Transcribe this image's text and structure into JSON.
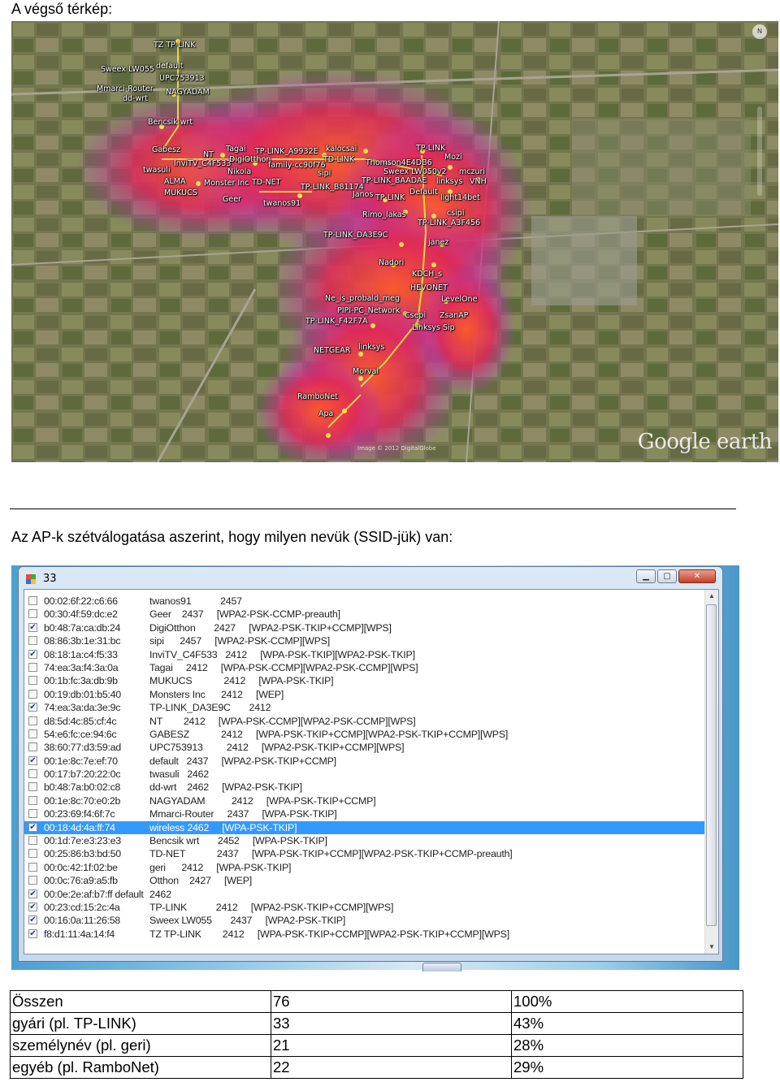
{
  "headings": {
    "map": "A végső térkép:",
    "list": "Az AP-k szétválogatása aszerint, hogy milyen nevük (SSID-jük) van:"
  },
  "map": {
    "attribution": "Image © 2012 DigitalGlobe",
    "brand": "Google earth",
    "compass": "N",
    "labels": [
      "TZ TP-LINK",
      "Sweex LW055",
      "default",
      "UPC753913",
      "Mmarci-Router",
      "NAGYADAM",
      "dd-wrt",
      "Bencsik wrt",
      "Gabesz",
      "NT",
      "Tagai",
      "TP-LINK_A9932E",
      "kalocsai",
      "InviTV_C4F533",
      "DigiOtthon",
      "family-cc90f76",
      "TD-LINK",
      "twasuli",
      "Nikola",
      "sipi",
      "Thomson4E4DB6",
      "TP-LINK",
      "Mozi",
      "Sweex LW050v2",
      "mczuri",
      "ALMA",
      "Monster Inc",
      "TD-NET",
      "TP-LINK_B81174",
      "TP-LINK_BAADAE",
      "linksys",
      "VNH",
      "MUKUCS",
      "Default",
      "Geer",
      "twanos91",
      "Janos",
      "TP-LINK",
      "light14bet",
      "Rimo_lakas",
      "csipi",
      "TP-LINK_A3F456",
      "TP-LINK_DA3E9C",
      "janez",
      "Nadori",
      "KDCH_s",
      "HEVONET",
      "Ne_is_probald_meg",
      "LevelOne",
      "PIPI-PC_Network",
      "Csepi",
      "ZsanAP",
      "TP-LINK_F42F7A",
      "Linksys Sip",
      "NETGEAR",
      "linksys",
      "Morval",
      "RamboNet",
      "Apa"
    ]
  },
  "window": {
    "title": "33",
    "rows": [
      {
        "checked": false,
        "mac": "00:02:6f:22:c6:66",
        "info": "twanos91           2457"
      },
      {
        "checked": false,
        "mac": "00:30:4f:59:dc:e2",
        "info": "Geer    2437     [WPA2-PSK-CCMP-preauth]"
      },
      {
        "checked": true,
        "mac": "b0:48:7a:ca:db:24",
        "info": "DigiOtthon       2427     [WPA2-PSK-TKIP+CCMP][WPS]"
      },
      {
        "checked": false,
        "mac": "08:86:3b:1e:31:bc",
        "info": "sipi      2457     [WPA2-PSK-CCMP][WPS]"
      },
      {
        "checked": true,
        "mac": "08:18:1a:c4:f5:33",
        "info": "InviTV_C4F533   2412     [WPA-PSK-TKIP][WPA2-PSK-TKIP]"
      },
      {
        "checked": false,
        "mac": "74:ea:3a:f4:3a:0a",
        "info": "Tagai     2412     [WPA-PSK-CCMP][WPA2-PSK-CCMP][WPS]"
      },
      {
        "checked": false,
        "mac": "00:1b:fc:3a:db:9b",
        "info": "MUKUCS            2412     [WPA-PSK-TKIP]"
      },
      {
        "checked": false,
        "mac": "00:19:db:01:b5:40",
        "info": "Monsters Inc      2412     [WEP]"
      },
      {
        "checked": true,
        "mac": "74:ea:3a:da:3e:9c",
        "info": "TP-LINK_DA3E9C       2412"
      },
      {
        "checked": false,
        "mac": "d8:5d:4c:85:cf:4c",
        "info": "NT        2412     [WPA-PSK-CCMP][WPA2-PSK-CCMP][WPS]"
      },
      {
        "checked": false,
        "mac": "54:e6:fc:ce:94:6c",
        "info": "GABESZ            2412     [WPA-PSK-TKIP+CCMP][WPA2-PSK-TKIP+CCMP][WPS]"
      },
      {
        "checked": false,
        "mac": "38:60:77:d3:59:ad",
        "info": "UPC753913         2412     [WPA2-PSK-TKIP+CCMP][WPS]"
      },
      {
        "checked": true,
        "mac": "00:1e:8c:7e:ef:70",
        "info": "default   2437     [WPA2-PSK-TKIP+CCMP]"
      },
      {
        "checked": false,
        "mac": "00:17:b7:20:22:0c",
        "info": "twasuli   2462"
      },
      {
        "checked": false,
        "mac": "b0:48:7a:b0:02:c8",
        "info": "dd-wrt    2462     [WPA2-PSK-TKIP]"
      },
      {
        "checked": false,
        "mac": "00:1e:8c:70:e0:2b",
        "info": "NAGYADAM          2412     [WPA-PSK-TKIP+CCMP]"
      },
      {
        "checked": false,
        "mac": "00:23:69:f4:6f:7c",
        "info": "Mmarci-Router     2437     [WPA-PSK-TKIP]"
      },
      {
        "checked": true,
        "selected": true,
        "mac": "00:18:4d:4a:ff:74",
        "info": "wireless 2462     [WPA-PSK-TKIP]"
      },
      {
        "checked": false,
        "mac": "00:1d:7e:e3:23:e3",
        "info": "Bencsik wrt       2452     [WPA-PSK-TKIP]"
      },
      {
        "checked": false,
        "mac": "00:25:86:b3:bd:50",
        "info": "TD-NET            2437     [WPA-PSK-TKIP+CCMP][WPA2-PSK-TKIP+CCMP-preauth]"
      },
      {
        "checked": false,
        "mac": "00:0c:42:1f:02:be",
        "info": "geri      2412     [WPA-PSK-TKIP]"
      },
      {
        "checked": false,
        "mac": "00:0c:76:a9:a5:fb",
        "info": "Otthon    2427     [WEP]"
      },
      {
        "checked": true,
        "mac": "00:0e:2e:af:b7:ff default",
        "info": "2462"
      },
      {
        "checked": true,
        "mac": "00:23:cd:15:2c:4a",
        "info": "TP-LINK           2412     [WPA2-PSK-TKIP+CCMP][WPS]"
      },
      {
        "checked": true,
        "mac": "00:16:0a:11:26:58",
        "info": "Sweex LW055       2437     [WPA2-PSK-TKIP]"
      },
      {
        "checked": true,
        "mac": "f8:d1:11:4a:14:f4",
        "info": "TZ TP-LINK        2412     [WPA-PSK-TKIP+CCMP][WPA2-PSK-TKIP+CCMP][WPS]"
      }
    ]
  },
  "summary": {
    "rows": [
      [
        "Összen",
        "76",
        "100%"
      ],
      [
        "gyári (pl. TP-LINK)",
        "33",
        "43%"
      ],
      [
        "személynév (pl. geri)",
        "21",
        "28%"
      ],
      [
        "egyéb (pl. RamboNet)",
        "22",
        "29%"
      ]
    ]
  }
}
